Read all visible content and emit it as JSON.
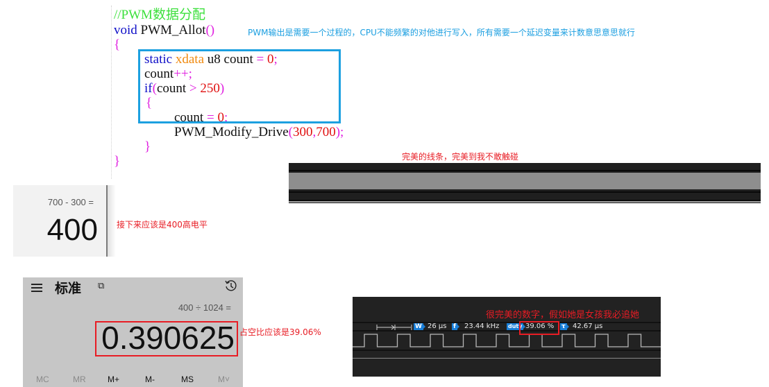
{
  "code": {
    "comment": "//PWM数据分配",
    "func_kw": "void",
    "func_name": " PWM_Allot",
    "func_parens": "()",
    "open_brace": "{",
    "line_static_kw": "static",
    "line_static_type": " xdata",
    "line_static_rest": " u8 count ",
    "line_static_eq": "=",
    "line_static_num": " 0",
    "line_static_semi": ";",
    "line_inc_var": "count",
    "line_inc_op": "++;",
    "line_if_kw": "if",
    "line_if_open": "(",
    "line_if_var": "count ",
    "line_if_op": ">",
    "line_if_num": " 250",
    "line_if_close": ")",
    "inner_open": "{",
    "line_reset_var": "count ",
    "line_reset_eq": "=",
    "line_reset_num": " 0",
    "line_reset_semi": ";",
    "call_name": "PWM_Modify_Drive",
    "call_open": "(",
    "call_arg1": "300",
    "call_comma": ",",
    "call_arg2": "700",
    "call_close": ");",
    "inner_close": "}",
    "close_brace": "}"
  },
  "annotations": {
    "code_note": "PWM输出是需要一个过程的，CPU不能频繁的对他进行写入，所有需要一个延迟变量来计数意思意思就行",
    "line_note": "完美的线条，完美到我不敢触碰",
    "high_level_note": "接下来应该是400高电平",
    "duty_note": "占空比应该是39.06%",
    "analyzer_note": "很完美的数字，假如她是女孩我必追她"
  },
  "calc_small": {
    "expression": "700 - 300 =",
    "result": "400"
  },
  "calc_large": {
    "mode_title": "标准",
    "keep_on_top_glyph": "⧉",
    "expression": "400 ÷ 1024 =",
    "result": "0.390625",
    "memory_buttons": [
      {
        "label": "MC",
        "enabled": false
      },
      {
        "label": "MR",
        "enabled": false
      },
      {
        "label": "M+",
        "enabled": true
      },
      {
        "label": "M-",
        "enabled": true
      },
      {
        "label": "MS",
        "enabled": true
      },
      {
        "label": "M˅",
        "enabled": false
      }
    ]
  },
  "analyzer": {
    "width_badge": "W",
    "width_value": "26 µs",
    "freq_badge": "f",
    "freq_value": "23.44 kHz",
    "duty_badge": "duty",
    "duty_value": "39.06 %",
    "period_badge": "τ",
    "period_value": "42.67 µs",
    "duty_fraction": 0.3906,
    "colors": {
      "badge": "#1a7fd8",
      "highlight": "#e81c24",
      "wave": "#b8b8b8"
    }
  }
}
